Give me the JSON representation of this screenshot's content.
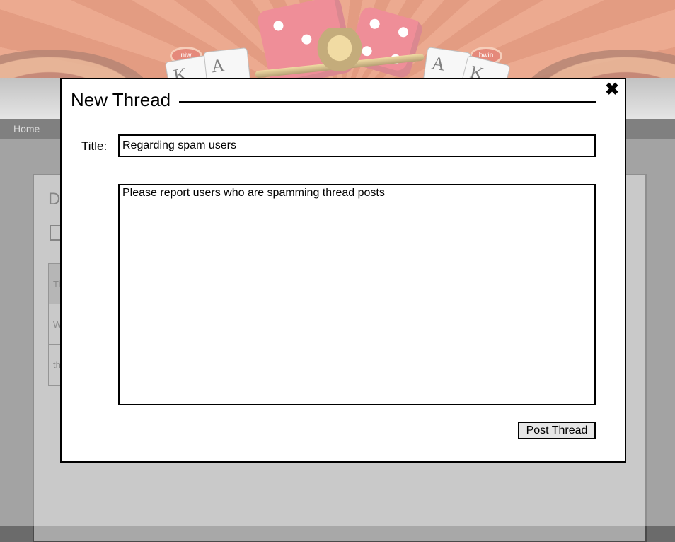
{
  "navbar": {
    "home_label": "Home"
  },
  "banner": {
    "chip_left_text": "niw",
    "chip_right_text": "bwin",
    "card_a": "A",
    "card_k": "K"
  },
  "content_panel": {
    "heading_partial": "D",
    "table_cells": [
      "Ti",
      "W",
      "th"
    ]
  },
  "modal": {
    "title": "New Thread",
    "close_glyph": "✖",
    "title_field_label": "Title:",
    "title_field_value": "Regarding spam users",
    "body_value": "Please report users who are spamming thread posts",
    "post_button_label": "Post Thread"
  },
  "colors": {
    "overlay": "rgba(255,255,255,0.38)",
    "navbar": "#333333",
    "banner_orange": "#d25f36"
  }
}
